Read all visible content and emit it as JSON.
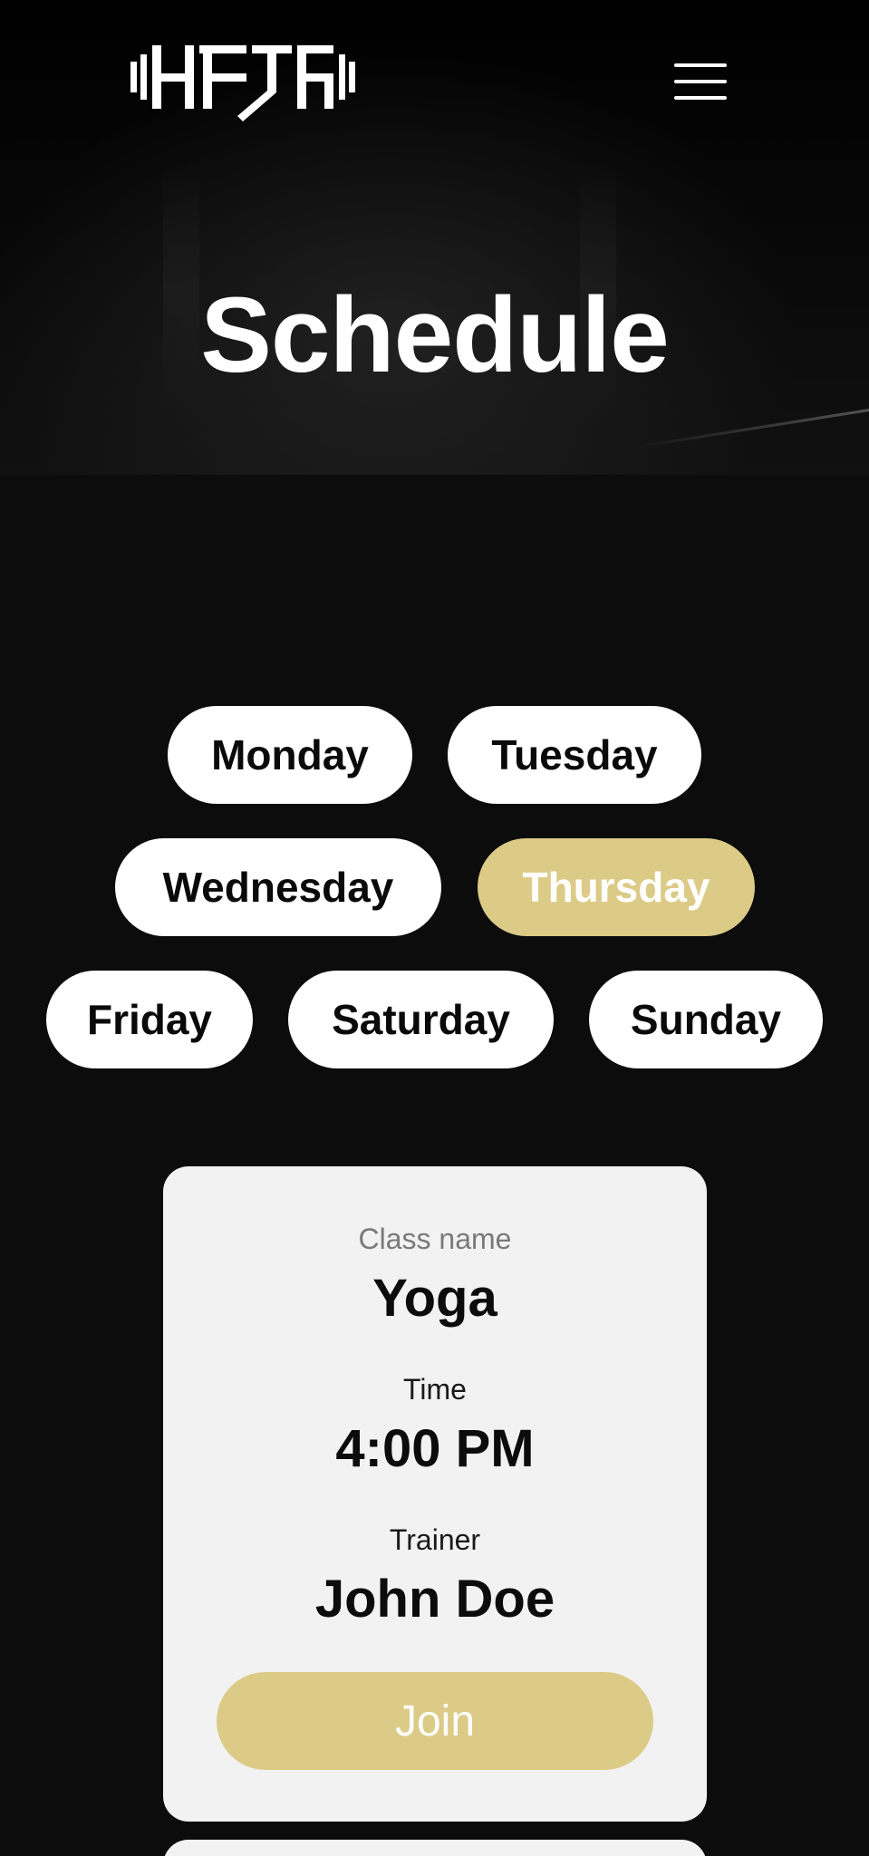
{
  "header": {
    "logo_icon": "hatf-logo",
    "menu_icon": "hamburger-icon",
    "title": "Schedule"
  },
  "days": {
    "items": [
      {
        "label": "Monday",
        "active": false
      },
      {
        "label": "Tuesday",
        "active": false
      },
      {
        "label": "Wednesday",
        "active": false
      },
      {
        "label": "Thursday",
        "active": true
      },
      {
        "label": "Friday",
        "active": false
      },
      {
        "label": "Saturday",
        "active": false
      },
      {
        "label": "Sunday",
        "active": false
      }
    ]
  },
  "class_card": {
    "class_name_label": "Class name",
    "class_name": "Yoga",
    "time_label": "Time",
    "time": "4:00 PM",
    "trainer_label": "Trainer",
    "trainer": "John Doe",
    "join_label": "Join"
  },
  "colors": {
    "accent": "#dccb87",
    "background": "#0c0c0c",
    "card": "#f2f2f2"
  }
}
